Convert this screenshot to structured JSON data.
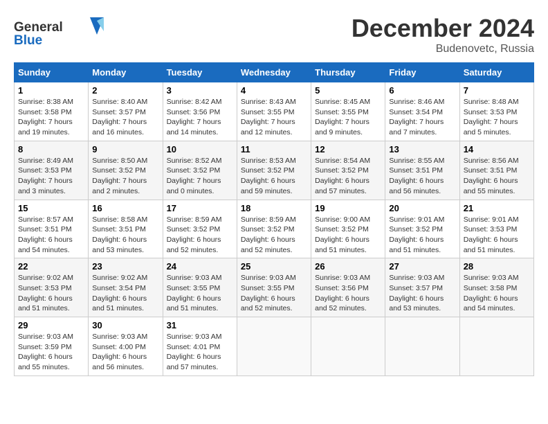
{
  "header": {
    "logo_general": "General",
    "logo_blue": "Blue",
    "month_year": "December 2024",
    "location": "Budenovetc, Russia"
  },
  "weekdays": [
    "Sunday",
    "Monday",
    "Tuesday",
    "Wednesday",
    "Thursday",
    "Friday",
    "Saturday"
  ],
  "weeks": [
    [
      {
        "day": 1,
        "sunrise": "8:38 AM",
        "sunset": "3:58 PM",
        "daylight": "7 hours and 19 minutes."
      },
      {
        "day": 2,
        "sunrise": "8:40 AM",
        "sunset": "3:57 PM",
        "daylight": "7 hours and 16 minutes."
      },
      {
        "day": 3,
        "sunrise": "8:42 AM",
        "sunset": "3:56 PM",
        "daylight": "7 hours and 14 minutes."
      },
      {
        "day": 4,
        "sunrise": "8:43 AM",
        "sunset": "3:55 PM",
        "daylight": "7 hours and 12 minutes."
      },
      {
        "day": 5,
        "sunrise": "8:45 AM",
        "sunset": "3:55 PM",
        "daylight": "7 hours and 9 minutes."
      },
      {
        "day": 6,
        "sunrise": "8:46 AM",
        "sunset": "3:54 PM",
        "daylight": "7 hours and 7 minutes."
      },
      {
        "day": 7,
        "sunrise": "8:48 AM",
        "sunset": "3:53 PM",
        "daylight": "7 hours and 5 minutes."
      }
    ],
    [
      {
        "day": 8,
        "sunrise": "8:49 AM",
        "sunset": "3:53 PM",
        "daylight": "7 hours and 3 minutes."
      },
      {
        "day": 9,
        "sunrise": "8:50 AM",
        "sunset": "3:52 PM",
        "daylight": "7 hours and 2 minutes."
      },
      {
        "day": 10,
        "sunrise": "8:52 AM",
        "sunset": "3:52 PM",
        "daylight": "7 hours and 0 minutes."
      },
      {
        "day": 11,
        "sunrise": "8:53 AM",
        "sunset": "3:52 PM",
        "daylight": "6 hours and 59 minutes."
      },
      {
        "day": 12,
        "sunrise": "8:54 AM",
        "sunset": "3:52 PM",
        "daylight": "6 hours and 57 minutes."
      },
      {
        "day": 13,
        "sunrise": "8:55 AM",
        "sunset": "3:51 PM",
        "daylight": "6 hours and 56 minutes."
      },
      {
        "day": 14,
        "sunrise": "8:56 AM",
        "sunset": "3:51 PM",
        "daylight": "6 hours and 55 minutes."
      }
    ],
    [
      {
        "day": 15,
        "sunrise": "8:57 AM",
        "sunset": "3:51 PM",
        "daylight": "6 hours and 54 minutes."
      },
      {
        "day": 16,
        "sunrise": "8:58 AM",
        "sunset": "3:51 PM",
        "daylight": "6 hours and 53 minutes."
      },
      {
        "day": 17,
        "sunrise": "8:59 AM",
        "sunset": "3:52 PM",
        "daylight": "6 hours and 52 minutes."
      },
      {
        "day": 18,
        "sunrise": "8:59 AM",
        "sunset": "3:52 PM",
        "daylight": "6 hours and 52 minutes."
      },
      {
        "day": 19,
        "sunrise": "9:00 AM",
        "sunset": "3:52 PM",
        "daylight": "6 hours and 51 minutes."
      },
      {
        "day": 20,
        "sunrise": "9:01 AM",
        "sunset": "3:52 PM",
        "daylight": "6 hours and 51 minutes."
      },
      {
        "day": 21,
        "sunrise": "9:01 AM",
        "sunset": "3:53 PM",
        "daylight": "6 hours and 51 minutes."
      }
    ],
    [
      {
        "day": 22,
        "sunrise": "9:02 AM",
        "sunset": "3:53 PM",
        "daylight": "6 hours and 51 minutes."
      },
      {
        "day": 23,
        "sunrise": "9:02 AM",
        "sunset": "3:54 PM",
        "daylight": "6 hours and 51 minutes."
      },
      {
        "day": 24,
        "sunrise": "9:03 AM",
        "sunset": "3:55 PM",
        "daylight": "6 hours and 51 minutes."
      },
      {
        "day": 25,
        "sunrise": "9:03 AM",
        "sunset": "3:55 PM",
        "daylight": "6 hours and 52 minutes."
      },
      {
        "day": 26,
        "sunrise": "9:03 AM",
        "sunset": "3:56 PM",
        "daylight": "6 hours and 52 minutes."
      },
      {
        "day": 27,
        "sunrise": "9:03 AM",
        "sunset": "3:57 PM",
        "daylight": "6 hours and 53 minutes."
      },
      {
        "day": 28,
        "sunrise": "9:03 AM",
        "sunset": "3:58 PM",
        "daylight": "6 hours and 54 minutes."
      }
    ],
    [
      {
        "day": 29,
        "sunrise": "9:03 AM",
        "sunset": "3:59 PM",
        "daylight": "6 hours and 55 minutes."
      },
      {
        "day": 30,
        "sunrise": "9:03 AM",
        "sunset": "4:00 PM",
        "daylight": "6 hours and 56 minutes."
      },
      {
        "day": 31,
        "sunrise": "9:03 AM",
        "sunset": "4:01 PM",
        "daylight": "6 hours and 57 minutes."
      },
      null,
      null,
      null,
      null
    ]
  ]
}
